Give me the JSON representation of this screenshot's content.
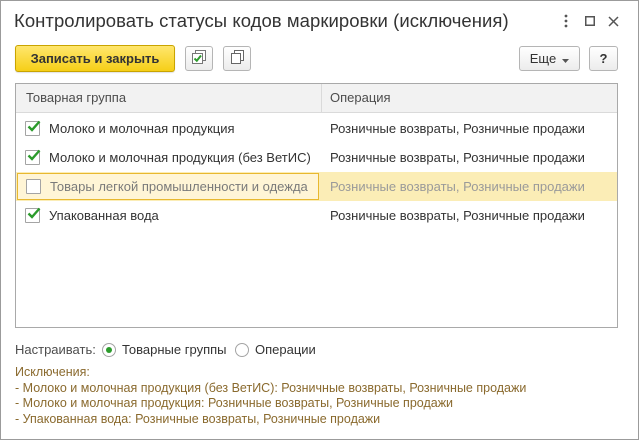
{
  "window": {
    "title": "Контролировать статусы кодов маркировки (исключения)"
  },
  "toolbar": {
    "save_close_label": "Записать и закрыть",
    "more_label": "Еще",
    "help_label": "?"
  },
  "grid": {
    "columns": [
      "Товарная группа",
      "Операция"
    ],
    "rows": [
      {
        "checked": true,
        "group": "Молоко и молочная продукция",
        "operation": "Розничные возвраты, Розничные продажи"
      },
      {
        "checked": true,
        "group": "Молоко и молочная продукция (без ВетИС)",
        "operation": "Розничные возвраты, Розничные продажи"
      },
      {
        "checked": false,
        "group": "Товары легкой промышленности и одежда",
        "operation": "Розничные возвраты, Розничные продажи"
      },
      {
        "checked": true,
        "group": "Упакованная вода",
        "operation": "Розничные возвраты, Розничные продажи"
      }
    ]
  },
  "settings": {
    "caption": "Настраивать:",
    "option_groups": "Товарные группы",
    "option_operations": "Операции",
    "selected": "Товарные группы"
  },
  "exceptions": {
    "title": "Исключения:",
    "lines": [
      "- Молоко и молочная продукция (без ВетИС): Розничные возвраты, Розничные продажи",
      "- Молоко и молочная продукция: Розничные возвраты, Розничные продажи",
      "- Упакованная вода: Розничные возвраты, Розничные продажи"
    ]
  },
  "colors": {
    "primary_button": "#f6cf17",
    "check_green": "#2c9b2c",
    "selected_row": "#fbedb6",
    "selected_border": "#e8b830",
    "exceptions_text": "#8a6a2e"
  },
  "icons": {
    "more_options": "kebab-icon",
    "maximize": "maximize-icon",
    "close": "close-icon",
    "check_all": "check-all-icon",
    "copy": "copy-icon",
    "dropdown": "chevron-down-icon"
  }
}
